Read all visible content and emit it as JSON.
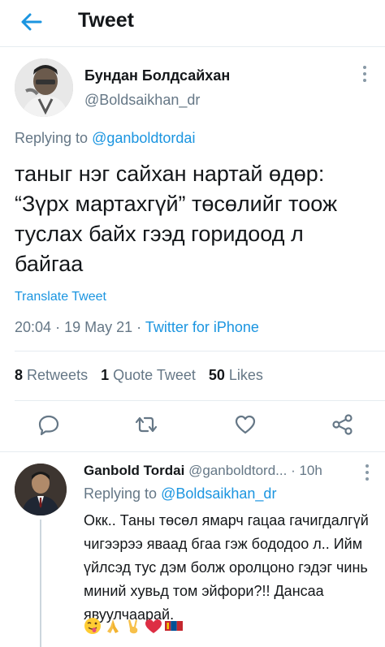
{
  "header": {
    "title": "Tweet"
  },
  "tweet": {
    "author_name": "Бундан Болдсайхан",
    "author_handle": "@Boldsaikhan_dr",
    "replying_prefix": "Replying to",
    "replying_to": "@ganboldtordai",
    "text": "таныг нэг сайхан нартай өдөр: “Зүрх мартахгүй” төсөлийг тоож туслах байх гээд горидоод л байгаа",
    "translate": "Translate Tweet",
    "time": "20:04",
    "date": "19 May 21",
    "source": "Twitter for iPhone",
    "stats": {
      "retweets_count": "8",
      "retweets_label": "Retweets",
      "quotes_count": "1",
      "quotes_label": "Quote Tweet",
      "likes_count": "50",
      "likes_label": "Likes"
    }
  },
  "reply": {
    "author_name": "Ganbold Tordai",
    "author_handle": "@ganboldtord...",
    "age": "10h",
    "replying_prefix": "Replying to",
    "replying_to": "@Boldsaikhan_dr",
    "text": "Окк.. Таны төсөл ямарч гацаа гачигдалгүй чигээрээ яваад бгаа гэж бододоо л.. Ийм үйлсэд тус дэм болж оролцоно гэдэг чинь миний хувьд том эйфори?!! Дансаа явуулчаарай.",
    "emojis": [
      "winking-tongue-face",
      "folded-hands",
      "victory-hand",
      "red-heart",
      "mongolia-flag"
    ]
  },
  "colors": {
    "accent": "#1b95e0",
    "secondary_text": "#657786",
    "divider": "#e6ecf0"
  }
}
